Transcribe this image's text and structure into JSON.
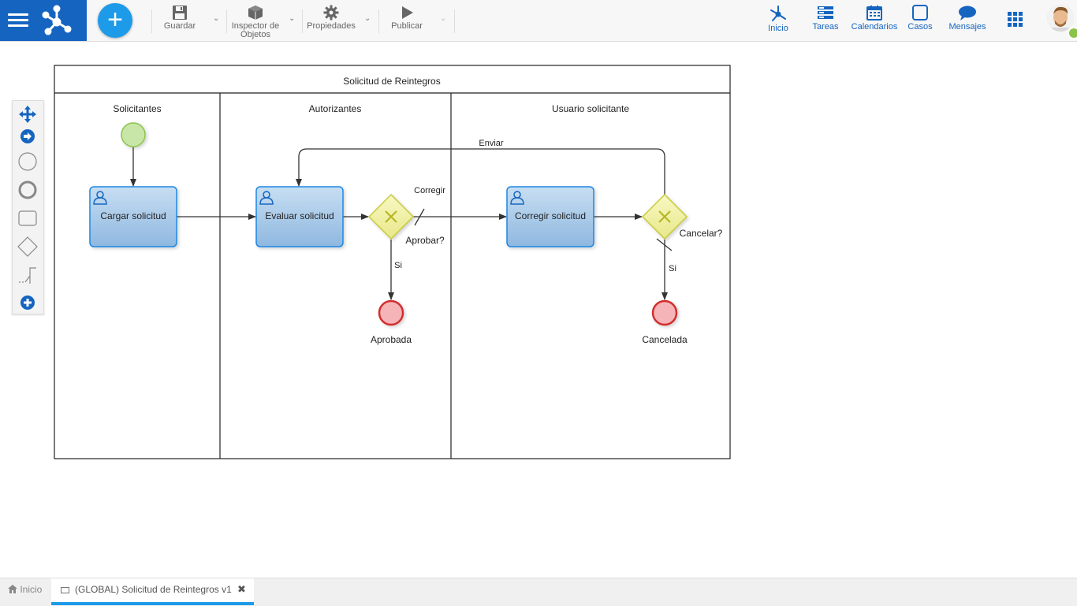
{
  "toolbar": {
    "save": "Guardar",
    "inspector_line1": "Inspector de",
    "inspector_line2": "Objetos",
    "properties": "Propiedades",
    "publish": "Publicar"
  },
  "nav": {
    "home": "Inicio",
    "tasks": "Tareas",
    "calendars": "Calendarios",
    "cases": "Casos",
    "messages": "Mensajes"
  },
  "diagram": {
    "pool_title": "Solicitud de Reintegros",
    "lanes": [
      "Solicitantes",
      "Autorizantes",
      "Usuario solicitante"
    ],
    "tasks": {
      "load": "Cargar solicitud",
      "evaluate": "Evaluar solicitud",
      "correct": "Corregir solicitud"
    },
    "gateways": {
      "approve": "Aprobar?",
      "cancel": "Cancelar?"
    },
    "flows": {
      "send": "Enviar",
      "correct": "Corregir",
      "yes1": "Si",
      "yes2": "Si"
    },
    "ends": {
      "approved": "Aprobada",
      "cancelled": "Cancelada"
    }
  },
  "tabs": {
    "home": "Inicio",
    "active": "(GLOBAL) Solicitud de Reintegros v1"
  },
  "colors": {
    "brand": "#1565c0",
    "accent": "#1e9be8",
    "task_fill": "#a9cbe8",
    "gateway_fill": "#f1f1a3",
    "start_fill": "#c8e6a8",
    "end_fill": "#f5b5b8"
  }
}
